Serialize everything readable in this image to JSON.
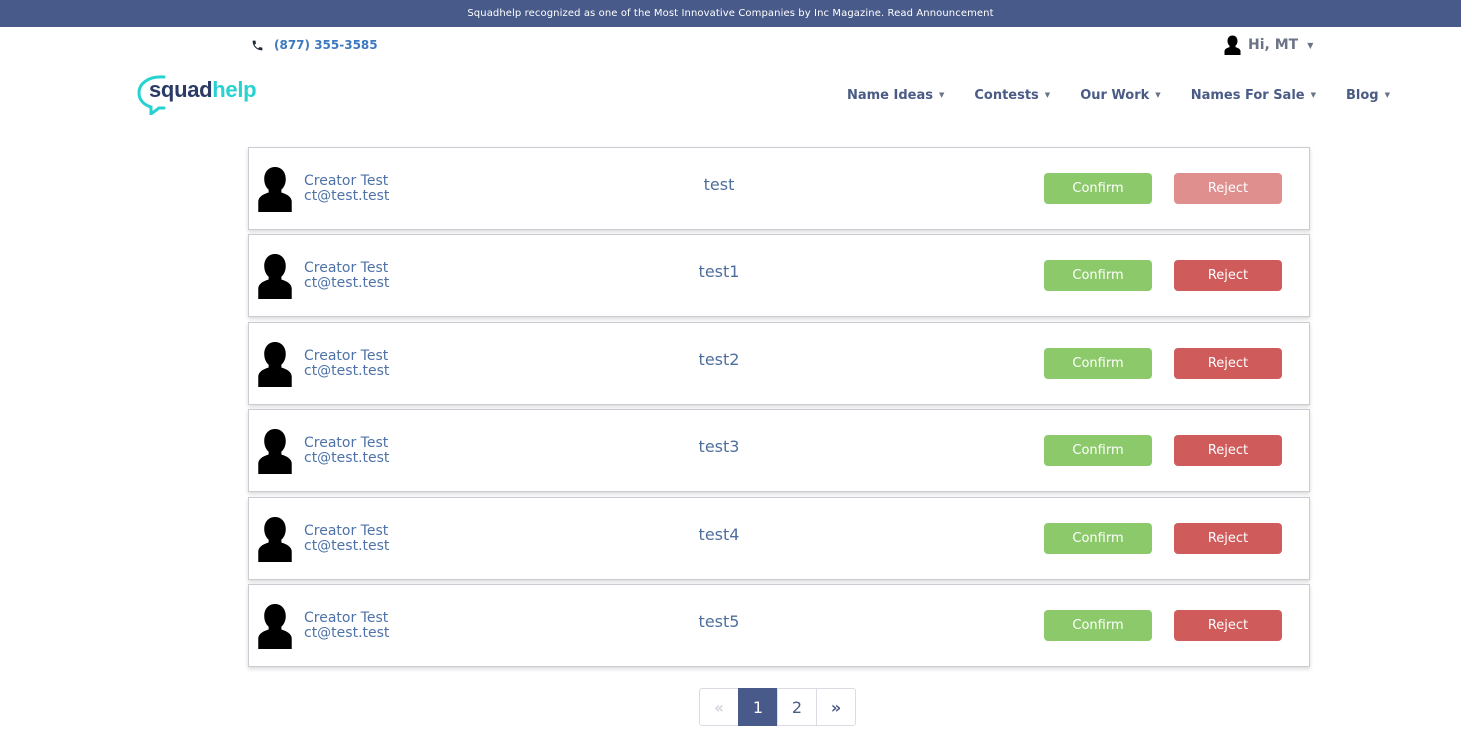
{
  "banner": {
    "text": "Squadhelp recognized as one of the Most Innovative Companies by Inc Magazine. Read Announcement"
  },
  "header": {
    "phone": "(877) 355-3585",
    "greeting": "Hi, MT",
    "logo": {
      "part1": "squad",
      "part2": "help"
    }
  },
  "nav": [
    {
      "label": "Name Ideas"
    },
    {
      "label": "Contests"
    },
    {
      "label": "Our Work"
    },
    {
      "label": "Names For Sale"
    },
    {
      "label": "Blog"
    }
  ],
  "offers": [
    {
      "creator_name": "Creator Test",
      "creator_email": "ct@test.test",
      "text": "test",
      "confirm": "Confirm",
      "reject": "Reject"
    },
    {
      "creator_name": "Creator Test",
      "creator_email": "ct@test.test",
      "text": "test1",
      "confirm": "Confirm",
      "reject": "Reject"
    },
    {
      "creator_name": "Creator Test",
      "creator_email": "ct@test.test",
      "text": "test2",
      "confirm": "Confirm",
      "reject": "Reject"
    },
    {
      "creator_name": "Creator Test",
      "creator_email": "ct@test.test",
      "text": "test3",
      "confirm": "Confirm",
      "reject": "Reject"
    },
    {
      "creator_name": "Creator Test",
      "creator_email": "ct@test.test",
      "text": "test4",
      "confirm": "Confirm",
      "reject": "Reject"
    },
    {
      "creator_name": "Creator Test",
      "creator_email": "ct@test.test",
      "text": "test5",
      "confirm": "Confirm",
      "reject": "Reject"
    }
  ],
  "pagination": {
    "prev": "«",
    "pages": [
      "1",
      "2"
    ],
    "next": "»",
    "current": "1"
  },
  "colors": {
    "banner": "#485a8a",
    "confirm": "#8cc96a",
    "reject": "#cf5c5b",
    "accent_teal": "#28d2d1"
  },
  "icons": {
    "phone": "phone-icon",
    "avatar": "avatar-icon",
    "caret": "chevron-down-icon"
  }
}
